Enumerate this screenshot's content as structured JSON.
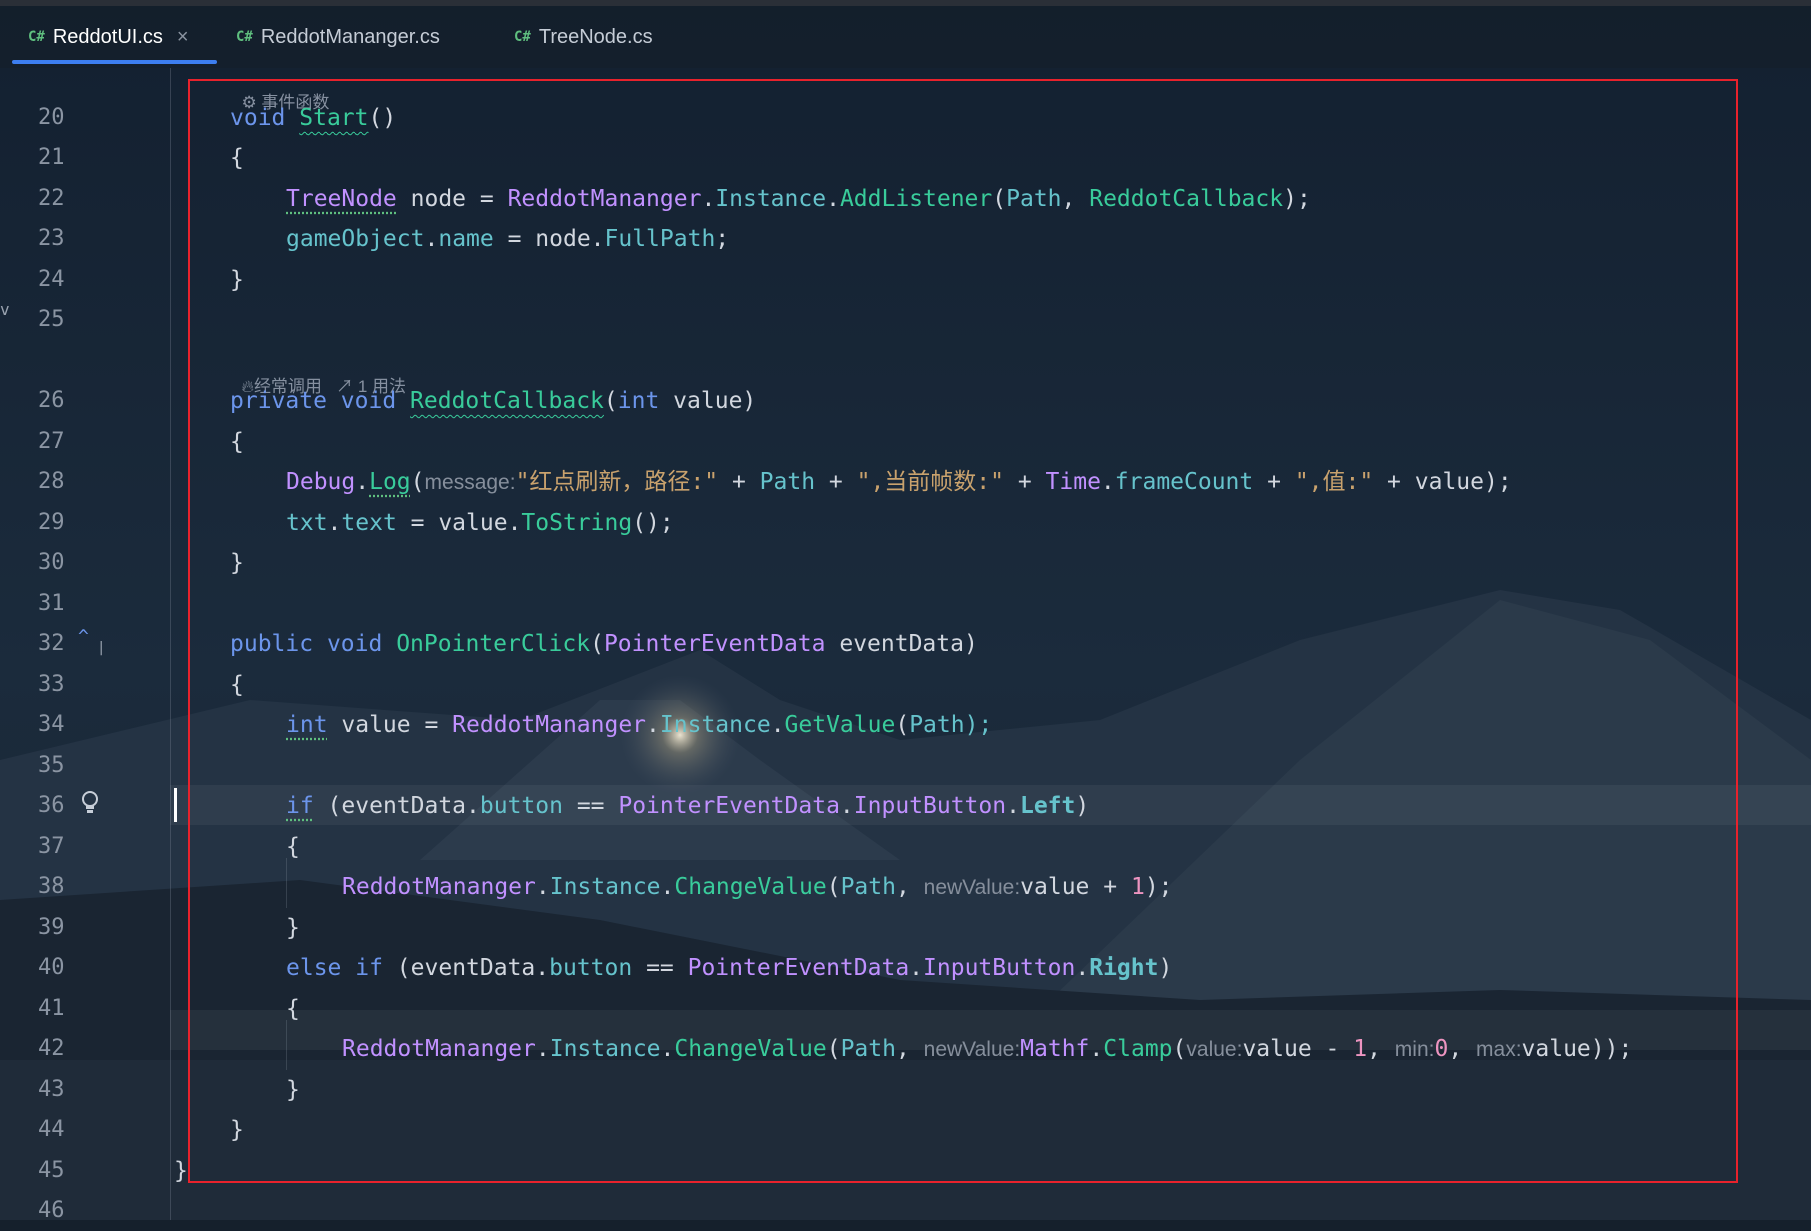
{
  "tabs": [
    {
      "icon": "C#",
      "label": "ReddotUI.cs",
      "close": "×"
    },
    {
      "icon": "C#",
      "label": "ReddotMananger.cs"
    },
    {
      "icon": "C#",
      "label": "TreeNode.cs"
    }
  ],
  "hints": {
    "event_function": "事件函数",
    "frequently_called": "经常调用",
    "usages": "1 用法"
  },
  "line_numbers": [
    "20",
    "21",
    "22",
    "23",
    "24",
    "25",
    "26",
    "27",
    "28",
    "29",
    "30",
    "31",
    "32",
    "33",
    "34",
    "35",
    "36",
    "37",
    "38",
    "39",
    "40",
    "41",
    "42",
    "43",
    "44",
    "45",
    "46"
  ],
  "code": {
    "void": "void",
    "start": "Start",
    "parens": "()",
    "brace_open": "{",
    "brace_close": "}",
    "treenode": "TreeNode",
    "node_var": " node = ",
    "reddotmananger": "ReddotMananger",
    "dot": ".",
    "instance": "Instance",
    "addlistener": "AddListener",
    "open_paren": "(",
    "path": "Path",
    "comma_space": ", ",
    "reddotcallback": "ReddotCallback",
    "close_semi": ");",
    "gameobject": "gameObject",
    "name": "name",
    "eq_node": " = node.",
    "fullpath": "FullPath",
    "semi": ";",
    "private": "private",
    "int": "int",
    "value_param": " value)",
    "debug": "Debug",
    "log": "Log",
    "message_hint": "message:",
    "str1": "\"红点刷新，路径:\"",
    "plus": " + ",
    "str2": "\",当前帧数:\"",
    "time": "Time",
    "framecount": "frameCount",
    "str3": "\",值:\"",
    "value_end": " + value);",
    "txt": "txt",
    "text": "text",
    "eq_value": " = value.",
    "tostring": "ToString",
    "call_end": "();",
    "public": "public",
    "onpointerclick": "OnPointerClick",
    "pointereventdata": "PointerEventData",
    "eventdata_param": " eventData)",
    "value_assign": " value = ",
    "getvalue": "GetValue",
    "path_close": "Path);",
    "if": "if",
    "cond_open": " (eventData.",
    "button": "button",
    "eqeq": " == ",
    "inputbutton": "InputButton",
    "left": "Left",
    "close_paren": ")",
    "changevalue": "ChangeValue",
    "newvalue_hint": "newValue:",
    "value_plus": "value + ",
    "one": "1",
    "else": "else",
    "right": "Right",
    "mathf": "Mathf",
    "clamp": "Clamp",
    "value_hint": "value:",
    "value_minus": "value - ",
    "min_hint": "min:",
    "zero": "0",
    "max_hint": "max:",
    "value_close": "value));"
  }
}
